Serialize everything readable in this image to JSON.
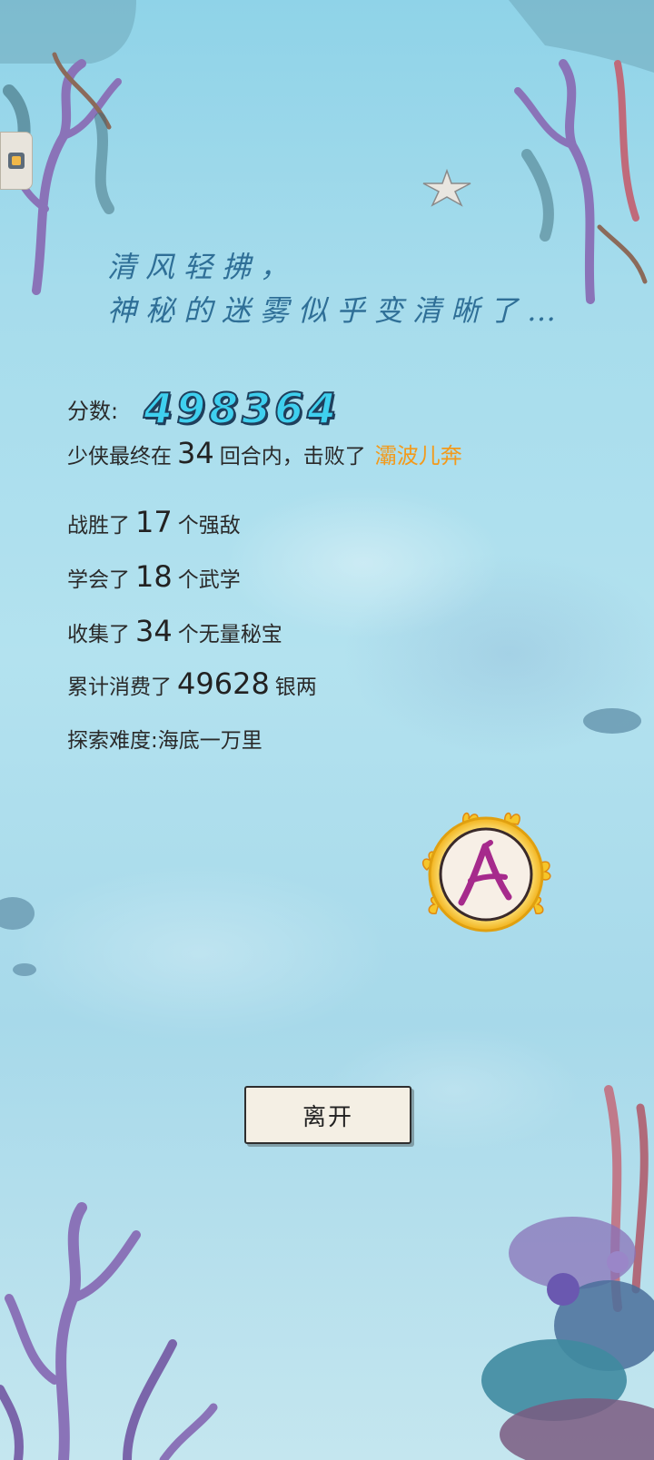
{
  "intro": {
    "line1": "清风轻拂，",
    "line2": "神秘的迷雾似乎变清晰了…"
  },
  "score": {
    "label": "分数:",
    "value": "498364"
  },
  "stats": {
    "battle": {
      "prefix": "少侠最终在",
      "rounds": "34",
      "middle": "回合内，击败了",
      "boss": "灞波儿奔"
    },
    "defeated": {
      "prefix": "战胜了",
      "count": "17",
      "suffix": "个强敌"
    },
    "learned": {
      "prefix": "学会了",
      "count": "18",
      "suffix": "个武学"
    },
    "collected": {
      "prefix": "收集了",
      "count": "34",
      "suffix": "个无量秘宝"
    },
    "spent": {
      "prefix": "累计消费了",
      "count": "49628",
      "suffix": "银两"
    },
    "difficulty": "探索难度:海底一万里"
  },
  "grade_badge": {
    "letter": "A",
    "icon": "grade-a-flame-ring-icon"
  },
  "leave_button": "离开",
  "colors": {
    "score": "#3fd0ef",
    "boss_name": "#f39a1b",
    "intro_text": "#2f6f97",
    "badge_letter": "#a62a8c"
  }
}
